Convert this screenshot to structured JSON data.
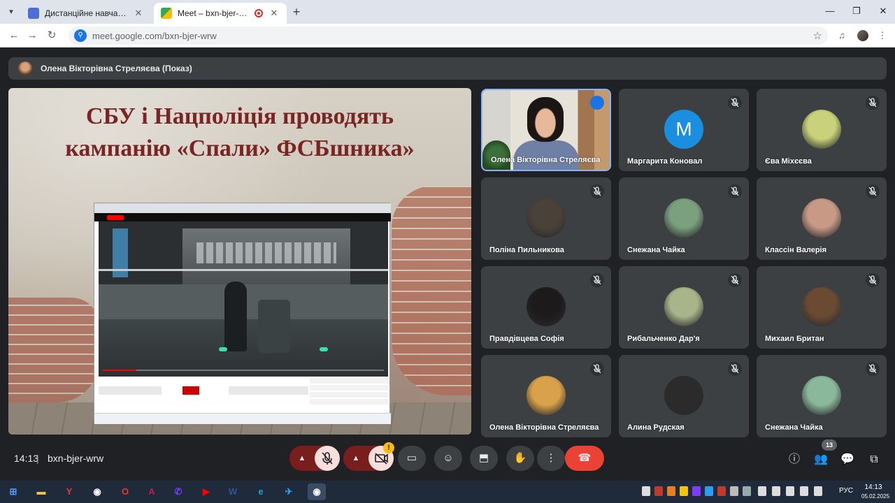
{
  "browser": {
    "tabs": [
      {
        "title": "Дистанційне навчання в ВСП",
        "icon": "google-classroom-icon",
        "active": false
      },
      {
        "title": "Meet – bxn-bjer-wrw",
        "icon": "google-meet-icon",
        "active": true
      }
    ],
    "url": "meet.google.com/bxn-bjer-wrw"
  },
  "meet": {
    "presenter_label": "Олена Вікторівна Стреляєва (Показ)",
    "slide": {
      "title_line1": "СБУ і Нацполіція проводять",
      "title_line2": "кампанію «Спали» ФСБшника»",
      "video_progress": 0.12
    },
    "participants": [
      {
        "name": "Олена Вікторівна Стреляєва",
        "type": "camera",
        "speaking": true
      },
      {
        "name": "Маргарита Коновал",
        "type": "initial",
        "initial": "M",
        "muted": true
      },
      {
        "name": "Єва Міхєєва",
        "type": "avatar",
        "muted": true,
        "color": "#c9d27a"
      },
      {
        "name": "Поліна Пильникова",
        "type": "avatar",
        "muted": true,
        "color": "#4a4238"
      },
      {
        "name": "Снежана Чайка",
        "type": "avatar",
        "muted": true,
        "color": "#7aa07e"
      },
      {
        "name": "Классін Валерія",
        "type": "avatar",
        "muted": true,
        "color": "#c89a86"
      },
      {
        "name": "Правдівцева Софія",
        "type": "avatar",
        "muted": true,
        "color": "#1d1a1c"
      },
      {
        "name": "Рибальченко Дар'я",
        "type": "avatar",
        "muted": true,
        "color": "#a8b48a"
      },
      {
        "name": "Михаил Британ",
        "type": "avatar",
        "muted": true,
        "color": "#6b4a34"
      },
      {
        "name": "Олена Вікторівна Стреляєва",
        "type": "avatar",
        "muted": true,
        "color": "#d9a24a"
      },
      {
        "name": "Алина Рудская",
        "type": "avatar",
        "muted": true,
        "color": "#2b2b2b"
      },
      {
        "name": "Снежана Чайка",
        "type": "avatar",
        "muted": true,
        "color": "#8ab89a"
      }
    ],
    "time": "14:13",
    "separator": "|",
    "meeting_code": "bxn-bjer-wrw",
    "people_count": "13",
    "colors": {
      "end_call": "#ea4335",
      "muted_group": "#7a1d1d",
      "speaking_border": "#8ab4f8"
    }
  },
  "taskbar": {
    "language": "РУС",
    "time": "14:13",
    "date": "05.02.2025",
    "apps": [
      "windows-icon",
      "file-explorer-icon",
      "yandex-icon",
      "chrome-icon",
      "opera-icon",
      "access-icon",
      "viber-icon",
      "youtube-icon",
      "word-icon",
      "edge-icon",
      "telegram-icon",
      "chrome-active-icon"
    ]
  }
}
